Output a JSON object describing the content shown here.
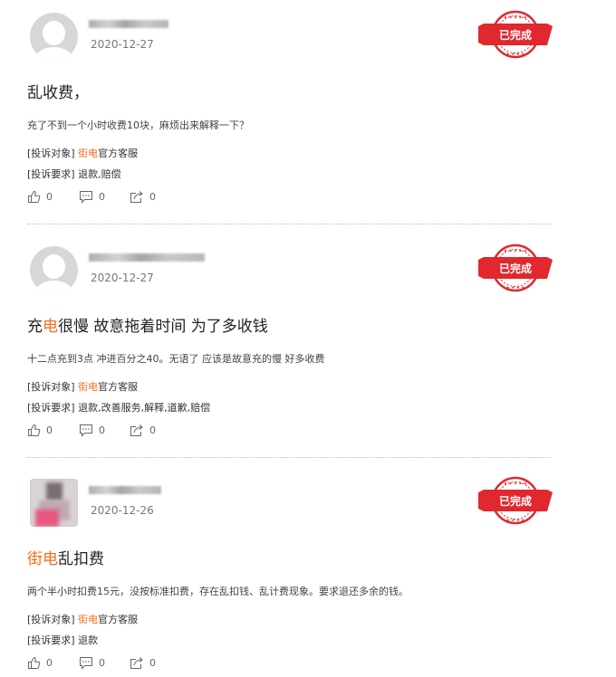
{
  "colors": {
    "accent": "#f56e1b",
    "stamp": "#e0282e"
  },
  "complaints": [
    {
      "date": "2020-12-27",
      "status": "已完成",
      "title_parts": [
        "乱收费，"
      ],
      "description": "充了不到一个小时收费10块，麻烦出来解释一下？",
      "target_label": "[投诉对象]",
      "target_link": "街电",
      "target_rest": "官方客服",
      "demand_label": "[投诉要求]",
      "demand": "退款,赔偿",
      "likes": "0",
      "comments": "0",
      "shares": "0"
    },
    {
      "date": "2020-12-27",
      "status": "已完成",
      "title_parts": [
        "充",
        "电",
        "很慢 故意拖着时间 为了多收钱"
      ],
      "description": "十二点充到3点 冲进百分之40。无语了 应该是故意充的慢 好多收费",
      "target_label": "[投诉对象]",
      "target_link": "街电",
      "target_rest": "官方客服",
      "demand_label": "[投诉要求]",
      "demand": "退款,改善服务,解释,道歉,赔偿",
      "likes": "0",
      "comments": "0",
      "shares": "0"
    },
    {
      "date": "2020-12-26",
      "status": "已完成",
      "title_parts": [
        "街电",
        "乱扣费"
      ],
      "description": "两个半小时扣费15元，没按标准扣费，存在乱扣钱、乱计费现象。要求退还多余的钱。",
      "target_label": "[投诉对象]",
      "target_link": "街电",
      "target_rest": "官方客服",
      "demand_label": "[投诉要求]",
      "demand": "退款",
      "likes": "0",
      "comments": "0",
      "shares": "0"
    }
  ]
}
